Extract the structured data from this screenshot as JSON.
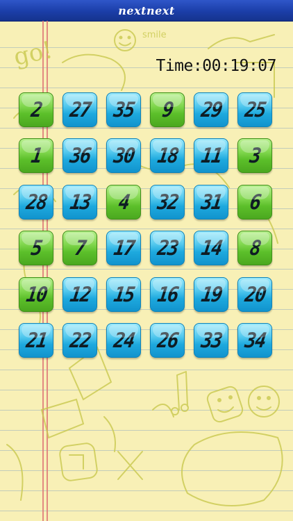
{
  "app": {
    "title": "nextnext"
  },
  "timer": {
    "text": "Time:00:19:07"
  },
  "tile_colors": {
    "found": "#6fd03d",
    "pending": "#35b8e8"
  },
  "board": {
    "rows": [
      [
        {
          "n": "2",
          "state": "green"
        },
        {
          "n": "27",
          "state": "blue"
        },
        {
          "n": "35",
          "state": "blue"
        },
        {
          "n": "9",
          "state": "green"
        },
        {
          "n": "29",
          "state": "blue"
        },
        {
          "n": "25",
          "state": "blue"
        }
      ],
      [
        {
          "n": "1",
          "state": "green"
        },
        {
          "n": "36",
          "state": "blue"
        },
        {
          "n": "30",
          "state": "blue"
        },
        {
          "n": "18",
          "state": "blue"
        },
        {
          "n": "11",
          "state": "blue"
        },
        {
          "n": "3",
          "state": "green"
        }
      ],
      [
        {
          "n": "28",
          "state": "blue"
        },
        {
          "n": "13",
          "state": "blue"
        },
        {
          "n": "4",
          "state": "green"
        },
        {
          "n": "32",
          "state": "blue"
        },
        {
          "n": "31",
          "state": "blue"
        },
        {
          "n": "6",
          "state": "green"
        }
      ],
      [
        {
          "n": "5",
          "state": "green"
        },
        {
          "n": "7",
          "state": "green"
        },
        {
          "n": "17",
          "state": "blue"
        },
        {
          "n": "23",
          "state": "blue"
        },
        {
          "n": "14",
          "state": "blue"
        },
        {
          "n": "8",
          "state": "green"
        }
      ],
      [
        {
          "n": "10",
          "state": "green"
        },
        {
          "n": "12",
          "state": "blue"
        },
        {
          "n": "15",
          "state": "blue"
        },
        {
          "n": "16",
          "state": "blue"
        },
        {
          "n": "19",
          "state": "blue"
        },
        {
          "n": "20",
          "state": "blue"
        }
      ],
      [
        {
          "n": "21",
          "state": "blue"
        },
        {
          "n": "22",
          "state": "blue"
        },
        {
          "n": "24",
          "state": "blue"
        },
        {
          "n": "26",
          "state": "blue"
        },
        {
          "n": "33",
          "state": "blue"
        },
        {
          "n": "34",
          "state": "blue"
        }
      ]
    ]
  },
  "background": {
    "doodle_text": [
      "smile",
      "go!"
    ]
  }
}
